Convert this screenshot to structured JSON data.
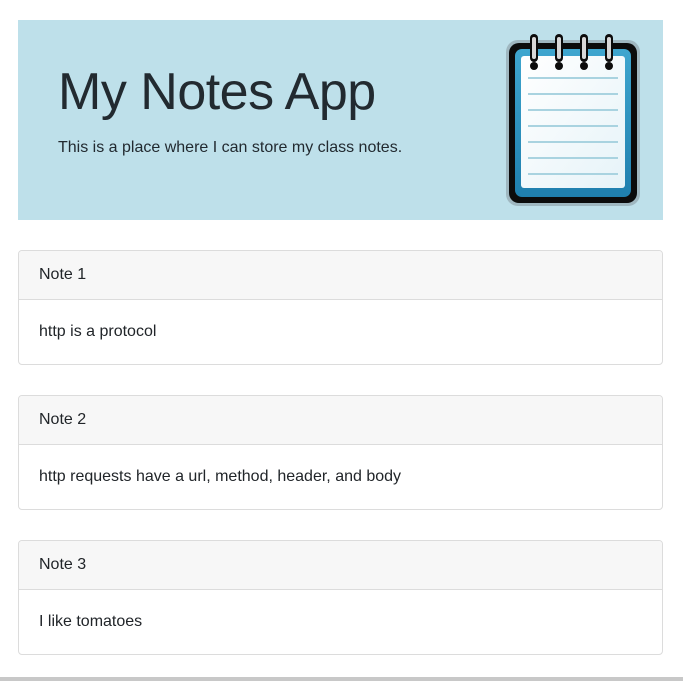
{
  "header": {
    "title": "My Notes App",
    "lead": "This is a place where I can store my class notes.",
    "icon": "notepad-icon",
    "background_color": "#bee0ea"
  },
  "notes": [
    {
      "title": "Note 1",
      "body": "http is a protocol"
    },
    {
      "title": "Note 2",
      "body": "http requests have a url, method, header, and body"
    },
    {
      "title": "Note 3",
      "body": "I like tomatoes"
    }
  ]
}
